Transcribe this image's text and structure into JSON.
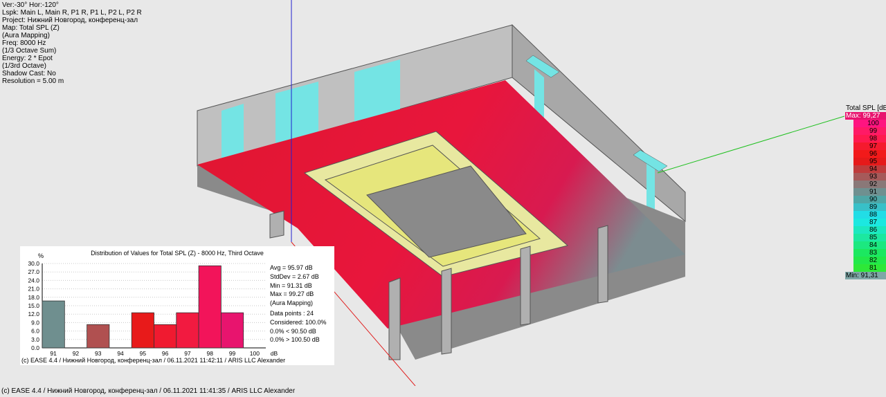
{
  "info": {
    "view": "Ver:-30°    Hor:-120°",
    "lspk": "Lspk: Main L, Main R, P1 R, P1 L, P2 L, P2 R",
    "project": "Project: Нижний Новгород, конференц-зал",
    "map": "Map: Total SPL (Z)",
    "mapping": "(Aura Mapping)",
    "freq": "Freq: 8000 Hz",
    "octave_sum": "(1/3 Octave Sum)",
    "energy": "Energy: 2 * Epot",
    "third_octave": "(1/3rd Octave)",
    "shadow": "Shadow Cast: No",
    "resolution": "Resolution =   5.00 m"
  },
  "legend": {
    "title": "Total SPL [dB]",
    "max": "Max:  99,27",
    "min": "Min:  91,31",
    "rows": [
      {
        "label": "100",
        "color": "#ff1480"
      },
      {
        "label": "99",
        "color": "#ff1a66"
      },
      {
        "label": "98",
        "color": "#ff1a4f"
      },
      {
        "label": "97",
        "color": "#f51a2e"
      },
      {
        "label": "96",
        "color": "#f21a1a"
      },
      {
        "label": "95",
        "color": "#e61a1a"
      },
      {
        "label": "94",
        "color": "#bf3c3c"
      },
      {
        "label": "93",
        "color": "#a65a5a"
      },
      {
        "label": "92",
        "color": "#8a7878"
      },
      {
        "label": "91",
        "color": "#6f9090"
      },
      {
        "label": "90",
        "color": "#4fa6a6"
      },
      {
        "label": "89",
        "color": "#38c0c8"
      },
      {
        "label": "88",
        "color": "#22dde6"
      },
      {
        "label": "87",
        "color": "#1ce8e0"
      },
      {
        "label": "86",
        "color": "#1ce8c0"
      },
      {
        "label": "85",
        "color": "#1ce8a0"
      },
      {
        "label": "84",
        "color": "#1ce880"
      },
      {
        "label": "83",
        "color": "#1ce860"
      },
      {
        "label": "82",
        "color": "#22e84a"
      },
      {
        "label": "81",
        "color": "#2ee838"
      }
    ]
  },
  "histogram": {
    "title": "Distribution of Values for Total SPL (Z) - 8000 Hz, Third Octave",
    "unit": "%",
    "xunit": "dB",
    "stats": {
      "avg": "Avg = 95.97 dB",
      "stddev": "StdDev = 2.67 dB",
      "min": "Min = 91.31 dB",
      "max": "Max = 99.27 dB",
      "mapping": "(Aura Mapping)",
      "points": "Data points : 24",
      "considered": "Considered: 100.0%",
      "below": "0.0%  < 90.50 dB",
      "above": "0.0%  > 100.50 dB"
    },
    "footer": "(c) EASE 4.4  / Нижний Новгород, конференц-зал  / 06.11.2021 11:42:11  / ARIS LLC Alexander"
  },
  "chart_data": {
    "type": "bar",
    "title": "Distribution of Values for Total SPL (Z) - 8000 Hz, Third Octave",
    "xlabel": "dB",
    "ylabel": "%",
    "categories": [
      "91",
      "92",
      "93",
      "94",
      "95",
      "96",
      "97",
      "98",
      "99",
      "100"
    ],
    "values": [
      16.7,
      0,
      8.3,
      0,
      12.5,
      8.3,
      12.5,
      29.2,
      12.5,
      0
    ],
    "colors": [
      "#6f8f8f",
      "#8a7878",
      "#b05050",
      "#c03030",
      "#e81a1a",
      "#f01a30",
      "#f21a40",
      "#f2145a",
      "#e8146e",
      "#e8146e"
    ],
    "yticks": [
      "0.0",
      "3.0",
      "6.0",
      "9.0",
      "12.0",
      "15.0",
      "18.0",
      "21.0",
      "24.0",
      "27.0",
      "30.0"
    ],
    "ylim": [
      0,
      30
    ],
    "grid": true
  },
  "statusbar": {
    "text": "(c) EASE 4.4  / Нижний Новгород, конференц-зал  / 06.11.2021 11:41:35  / ARIS LLC Alexander"
  }
}
